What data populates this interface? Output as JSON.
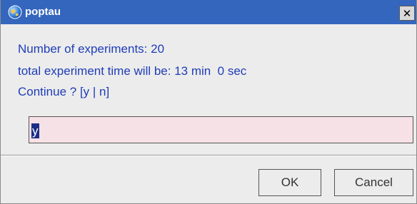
{
  "window": {
    "title": "poptau",
    "close_label": "✕",
    "titlebar_color": "#3466bd"
  },
  "message": {
    "line1": "Number of experiments: 20",
    "line2": "total experiment time will be: 13 min  0 sec",
    "line3": "Continue ? [y | n]",
    "text_color": "#1f3db8"
  },
  "input": {
    "value": "y",
    "background": "#f6e1e6"
  },
  "buttons": {
    "ok_label": "OK",
    "cancel_label": "Cancel"
  },
  "icons": {
    "app": "app-globe-icon",
    "close": "close-icon"
  }
}
